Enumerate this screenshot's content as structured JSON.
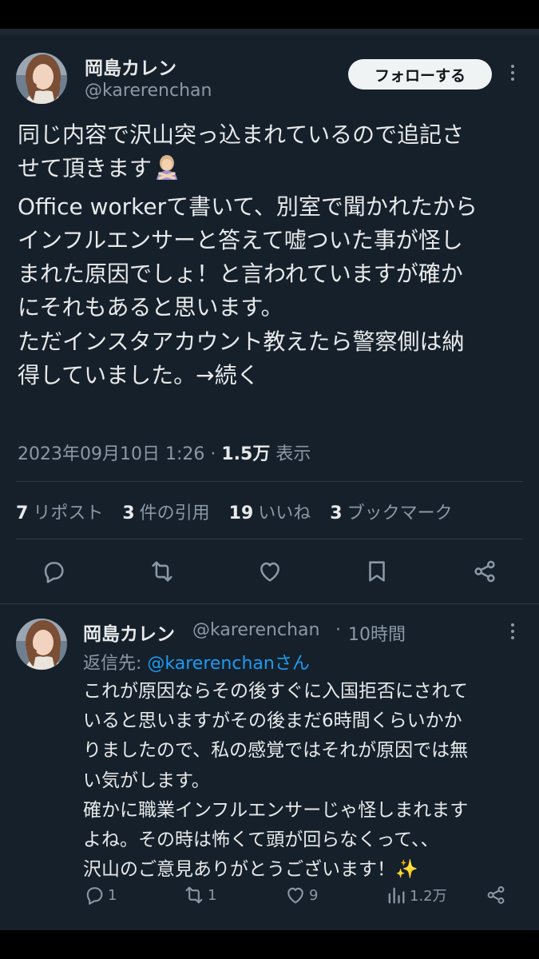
{
  "tweet": {
    "author_name": "岡島カレン",
    "author_handle": "@karerenchan",
    "follow_label": "フォローする",
    "text_lines": [
      "同じ内容で沢山突っ込まれているので追記さ",
      "せて頂きます",
      "Office workerて書いて、別室で聞かれたから",
      "インフルエンサーと答えて嘘ついた事が怪し",
      "まれた原因でしょ！と言われていますが確か",
      "にそれもあると思います。",
      "ただインスタアカウント教えたら警察側は納",
      "得していました。→続く"
    ],
    "emoji": "person-gesturing-no-emoji",
    "timestamp": "2023年09月10日 1:26",
    "separator": "·",
    "views_count": "1.5万",
    "views_label": "表示",
    "stats": {
      "reposts_count": "7",
      "reposts_label": "リポスト",
      "quotes_count": "3",
      "quotes_label": "件の引用",
      "likes_count": "19",
      "likes_label": "いいね",
      "bookmarks_count": "3",
      "bookmarks_label": "ブックマーク"
    },
    "actions": [
      "reply-icon",
      "repost-icon",
      "like-icon",
      "bookmark-icon",
      "share-icon"
    ]
  },
  "reply": {
    "author_name": "岡島カレン",
    "author_handle": "@karerenchan",
    "separator": "·",
    "time": "10時間",
    "reply_to_label": "返信先: ",
    "reply_to_mention": "@karerenchanさん",
    "text_lines": [
      "これが原因ならその後すぐに入国拒否にされて",
      "いると思いますがその後まだ6時間くらいかか",
      "りましたので、私の感覚ではそれが原因では無",
      "い気がします。",
      "確かに職業インフルエンサーじゃ怪しまれます",
      "よね。その時は怖くて頭が回らなくって、、",
      "沢山のご意見ありがとうございます！✨"
    ],
    "counts": {
      "replies": "1",
      "reposts": "1",
      "likes": "9",
      "views": "1.2万"
    }
  },
  "colors": {
    "background": "#15202b",
    "text": "#e7e9ea",
    "secondary_text": "#8b98a5",
    "accent": "#1d9bf0",
    "divider": "#2f3b47"
  }
}
